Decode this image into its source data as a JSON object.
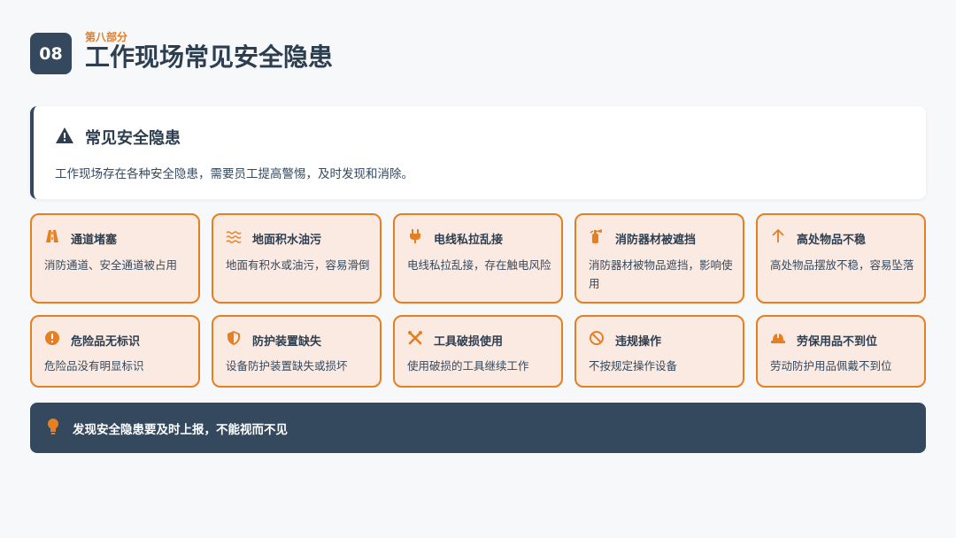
{
  "header": {
    "number": "08",
    "subtitle": "第八部分",
    "title": "工作现场常见安全隐患"
  },
  "intro": {
    "icon": "warning-icon",
    "title": "常见安全隐患",
    "text": "工作现场存在各种安全隐患，需要员工提高警惕，及时发现和消除。"
  },
  "cards": [
    {
      "icon": "road-icon",
      "title": "通道堵塞",
      "desc": "消防通道、安全通道被占用"
    },
    {
      "icon": "water-icon",
      "title": "地面积水油污",
      "desc": "地面有积水或油污，容易滑倒"
    },
    {
      "icon": "plug-icon",
      "title": "电线私拉乱接",
      "desc": "电线私拉乱接，存在触电风险"
    },
    {
      "icon": "fire-extinguisher-icon",
      "title": "消防器材被遮挡",
      "desc": "消防器材被物品遮挡，影响使用"
    },
    {
      "icon": "arrow-up-icon",
      "title": "高处物品不稳",
      "desc": "高处物品摆放不稳，容易坠落"
    },
    {
      "icon": "exclamation-circle-icon",
      "title": "危险品无标识",
      "desc": "危险品没有明显标识"
    },
    {
      "icon": "shield-icon",
      "title": "防护装置缺失",
      "desc": "设备防护装置缺失或损坏"
    },
    {
      "icon": "tools-icon",
      "title": "工具破损使用",
      "desc": "使用破损的工具继续工作"
    },
    {
      "icon": "ban-icon",
      "title": "违规操作",
      "desc": "不按规定操作设备"
    },
    {
      "icon": "hard-hat-icon",
      "title": "劳保用品不到位",
      "desc": "劳动防护用品佩戴不到位"
    }
  ],
  "footer": {
    "icon": "lightbulb-icon",
    "text": "发现安全隐患要及时上报，不能视而不见"
  },
  "colors": {
    "accent": "#e67e22",
    "primary": "#34495e",
    "card_bg": "#fbeae2",
    "page_bg": "#f7f8fa"
  }
}
